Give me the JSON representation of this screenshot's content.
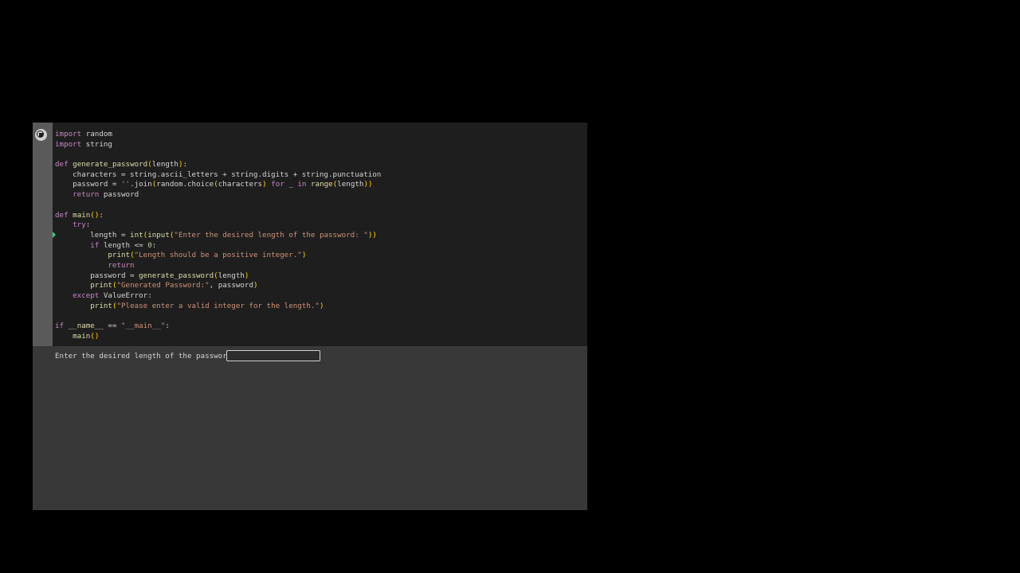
{
  "cell": {
    "run_icon": "stop-circle-icon",
    "exec_marker_icon": "execution-arrow-icon",
    "code_lines": [
      "import random",
      "import string",
      "",
      "def generate_password(length):",
      "    characters = string.ascii_letters + string.digits + string.punctuation",
      "    password = ''.join(random.choice(characters) for _ in range(length))",
      "    return password",
      "",
      "def main():",
      "    try:",
      "        length = int(input(\"Enter the desired length of the password: \"))",
      "        if length <= 0:",
      "            print(\"Length should be a positive integer.\")",
      "            return",
      "        password = generate_password(length)",
      "        print(\"Generated Password:\", password)",
      "    except ValueError:",
      "        print(\"Please enter a valid integer for the length.\")",
      "",
      "if __name__ == \"__main__\":",
      "    main()"
    ]
  },
  "output": {
    "prompt": "Enter the desired length of the password:",
    "input_value": "",
    "input_placeholder": ""
  },
  "colors": {
    "page_background": "#000000",
    "notebook_background": "#383838",
    "code_background": "#1e1e1e",
    "gutter": "#5a5a5a",
    "keyword": "#c586c0",
    "function": "#dcdcaa",
    "string": "#ce9178",
    "execution_marker": "#33d17a"
  }
}
